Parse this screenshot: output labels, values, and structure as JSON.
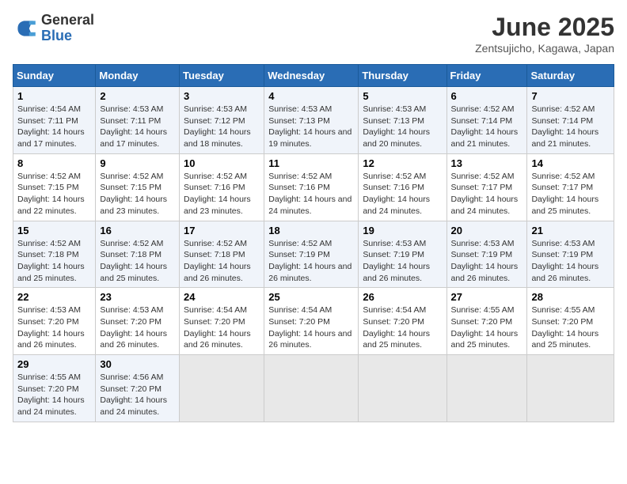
{
  "header": {
    "logo_general": "General",
    "logo_blue": "Blue",
    "month": "June 2025",
    "location": "Zentsujicho, Kagawa, Japan"
  },
  "days_of_week": [
    "Sunday",
    "Monday",
    "Tuesday",
    "Wednesday",
    "Thursday",
    "Friday",
    "Saturday"
  ],
  "weeks": [
    [
      {
        "day": "1",
        "sunrise": "4:54 AM",
        "sunset": "7:11 PM",
        "daylight": "14 hours and 17 minutes."
      },
      {
        "day": "2",
        "sunrise": "4:53 AM",
        "sunset": "7:11 PM",
        "daylight": "14 hours and 17 minutes."
      },
      {
        "day": "3",
        "sunrise": "4:53 AM",
        "sunset": "7:12 PM",
        "daylight": "14 hours and 18 minutes."
      },
      {
        "day": "4",
        "sunrise": "4:53 AM",
        "sunset": "7:13 PM",
        "daylight": "14 hours and 19 minutes."
      },
      {
        "day": "5",
        "sunrise": "4:53 AM",
        "sunset": "7:13 PM",
        "daylight": "14 hours and 20 minutes."
      },
      {
        "day": "6",
        "sunrise": "4:52 AM",
        "sunset": "7:14 PM",
        "daylight": "14 hours and 21 minutes."
      },
      {
        "day": "7",
        "sunrise": "4:52 AM",
        "sunset": "7:14 PM",
        "daylight": "14 hours and 21 minutes."
      }
    ],
    [
      {
        "day": "8",
        "sunrise": "4:52 AM",
        "sunset": "7:15 PM",
        "daylight": "14 hours and 22 minutes."
      },
      {
        "day": "9",
        "sunrise": "4:52 AM",
        "sunset": "7:15 PM",
        "daylight": "14 hours and 23 minutes."
      },
      {
        "day": "10",
        "sunrise": "4:52 AM",
        "sunset": "7:16 PM",
        "daylight": "14 hours and 23 minutes."
      },
      {
        "day": "11",
        "sunrise": "4:52 AM",
        "sunset": "7:16 PM",
        "daylight": "14 hours and 24 minutes."
      },
      {
        "day": "12",
        "sunrise": "4:52 AM",
        "sunset": "7:16 PM",
        "daylight": "14 hours and 24 minutes."
      },
      {
        "day": "13",
        "sunrise": "4:52 AM",
        "sunset": "7:17 PM",
        "daylight": "14 hours and 24 minutes."
      },
      {
        "day": "14",
        "sunrise": "4:52 AM",
        "sunset": "7:17 PM",
        "daylight": "14 hours and 25 minutes."
      }
    ],
    [
      {
        "day": "15",
        "sunrise": "4:52 AM",
        "sunset": "7:18 PM",
        "daylight": "14 hours and 25 minutes."
      },
      {
        "day": "16",
        "sunrise": "4:52 AM",
        "sunset": "7:18 PM",
        "daylight": "14 hours and 25 minutes."
      },
      {
        "day": "17",
        "sunrise": "4:52 AM",
        "sunset": "7:18 PM",
        "daylight": "14 hours and 26 minutes."
      },
      {
        "day": "18",
        "sunrise": "4:52 AM",
        "sunset": "7:19 PM",
        "daylight": "14 hours and 26 minutes."
      },
      {
        "day": "19",
        "sunrise": "4:53 AM",
        "sunset": "7:19 PM",
        "daylight": "14 hours and 26 minutes."
      },
      {
        "day": "20",
        "sunrise": "4:53 AM",
        "sunset": "7:19 PM",
        "daylight": "14 hours and 26 minutes."
      },
      {
        "day": "21",
        "sunrise": "4:53 AM",
        "sunset": "7:19 PM",
        "daylight": "14 hours and 26 minutes."
      }
    ],
    [
      {
        "day": "22",
        "sunrise": "4:53 AM",
        "sunset": "7:20 PM",
        "daylight": "14 hours and 26 minutes."
      },
      {
        "day": "23",
        "sunrise": "4:53 AM",
        "sunset": "7:20 PM",
        "daylight": "14 hours and 26 minutes."
      },
      {
        "day": "24",
        "sunrise": "4:54 AM",
        "sunset": "7:20 PM",
        "daylight": "14 hours and 26 minutes."
      },
      {
        "day": "25",
        "sunrise": "4:54 AM",
        "sunset": "7:20 PM",
        "daylight": "14 hours and 26 minutes."
      },
      {
        "day": "26",
        "sunrise": "4:54 AM",
        "sunset": "7:20 PM",
        "daylight": "14 hours and 25 minutes."
      },
      {
        "day": "27",
        "sunrise": "4:55 AM",
        "sunset": "7:20 PM",
        "daylight": "14 hours and 25 minutes."
      },
      {
        "day": "28",
        "sunrise": "4:55 AM",
        "sunset": "7:20 PM",
        "daylight": "14 hours and 25 minutes."
      }
    ],
    [
      {
        "day": "29",
        "sunrise": "4:55 AM",
        "sunset": "7:20 PM",
        "daylight": "14 hours and 24 minutes."
      },
      {
        "day": "30",
        "sunrise": "4:56 AM",
        "sunset": "7:20 PM",
        "daylight": "14 hours and 24 minutes."
      },
      null,
      null,
      null,
      null,
      null
    ]
  ],
  "labels": {
    "sunrise": "Sunrise:",
    "sunset": "Sunset:",
    "daylight": "Daylight:"
  }
}
